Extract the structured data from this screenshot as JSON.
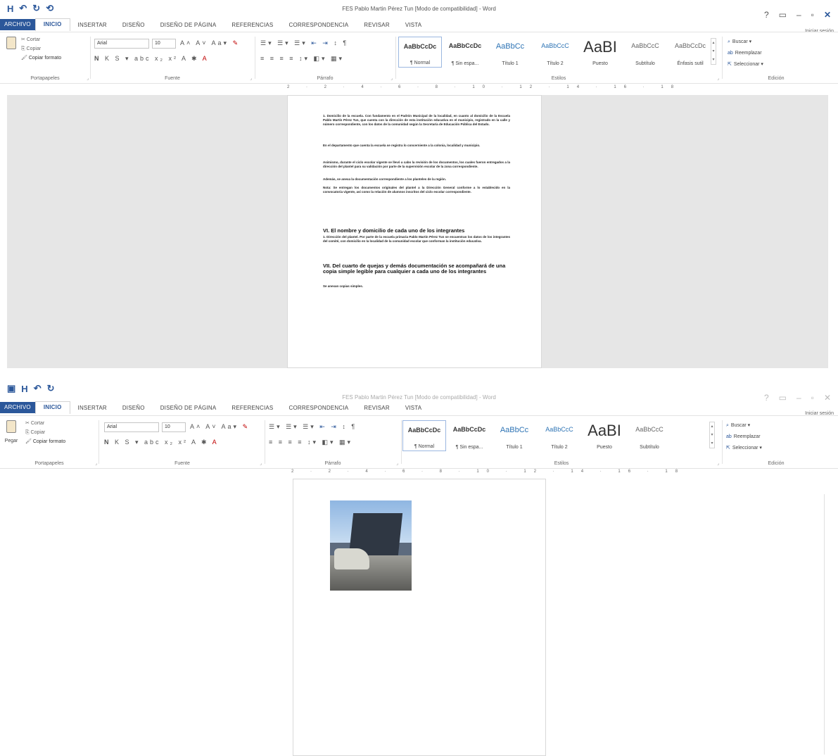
{
  "screen1": {
    "qat": [
      "H",
      "↶",
      "↻",
      "⟲"
    ],
    "title": "FES Pablo Martin Pérez Tun [Modo de compatibilidad] - Word",
    "window_controls": [
      "?",
      "▭",
      "–",
      "▫",
      "✕"
    ],
    "signin": "Iniciar sesión",
    "tabs": [
      "ARCHIVO",
      "INICIO",
      "INSERTAR",
      "DISEÑO",
      "DISEÑO DE PÁGINA",
      "REFERENCIAS",
      "CORRESPONDENCIA",
      "REVISAR",
      "VISTA"
    ],
    "clipboard": {
      "cut": "Cortar",
      "copy": "Copiar",
      "format_painter": "Copiar formato",
      "label": "Portapapeles"
    },
    "font": {
      "name": "Arial",
      "size": "10",
      "label": "Fuente"
    },
    "paragraph_label": "Párrafo",
    "styles": [
      {
        "sample": "AaBbCcDc",
        "name": "¶ Normal"
      },
      {
        "sample": "AaBbCcDc",
        "name": "¶ Sin espa..."
      },
      {
        "sample": "AaBbCc",
        "name": "Título 1"
      },
      {
        "sample": "AaBbCcC",
        "name": "Título 2"
      },
      {
        "sample": "AaBI",
        "name": "Puesto"
      },
      {
        "sample": "AaBbCcC",
        "name": "Subtítulo"
      },
      {
        "sample": "AaBbCcDc",
        "name": "Énfasis sutil"
      }
    ],
    "styles_label": "Estilos",
    "editing": {
      "find": "Buscar",
      "replace": "Reemplazar",
      "select": "Seleccionar",
      "label": "Edición"
    },
    "ruler": "2 · 2 · 4 · 6 · 8 · 10 · 12 · 14 · 16 · 18",
    "document": {
      "para1": "1. Domicilio de la escuela. Con fundamento en el Padrón Municipal de la localidad, en cuanto al domicilio de la Escuela Pablo Martín Pérez Tun, que cuenta con la dirección de esta institución educativa en el municipio, registrado en la calle y número correspondiente, con los datos de la comunidad según la Secretaría de Educación Pública del Estado.",
      "para2": "En el departamento que cuenta la escuela se registra lo concerniente a la colonia, localidad y municipio.",
      "para3": "Asimismo, durante el ciclo escolar vigente se llevó a cabo la revisión de los documentos, los cuales fueron entregados a la dirección del plantel para su validación por parte de la supervisión escolar de la zona correspondiente.",
      "para4": "Además, se anexa la documentación correspondiente a los planteles de la región.",
      "para5": "Nota: Se entregan los documentos originales del plantel a la Dirección General conforme a lo establecido en la convocatoria vigente, así como la relación de alumnos inscritos del ciclo escolar correspondiente.",
      "heading1": "VI. El nombre y domicilio de cada uno de los integrantes",
      "para6": "1. Dirección del plantel. Por parte de la escuela primaria Pablo Martín Pérez Tun se encuentran los datos de los integrantes del comité, con domicilio en la localidad de la comunidad escolar que conforman la institución educativa.",
      "heading2": "VII. Del cuarto de quejas y demás documentación se acompañará de una copia simple legible para cualquier a cada uno de los integrantes",
      "para7": "Se anexan copias simples."
    }
  },
  "screen2": {
    "qat": [
      "▣",
      "H",
      "↶",
      "↻"
    ],
    "title": "FES Pablo Martin Pérez Tun [Modo de compatibilidad] - Word",
    "window_controls": [
      "?",
      "▭",
      "–",
      "▫",
      "✕"
    ],
    "signin": "Iniciar sesión",
    "tabs": [
      "ARCHIVO",
      "INICIO",
      "INSERTAR",
      "DISEÑO",
      "DISEÑO DE PÁGINA",
      "REFERENCIAS",
      "CORRESPONDENCIA",
      "REVISAR",
      "VISTA"
    ],
    "clipboard": {
      "paste": "Pegar",
      "cut": "Cortar",
      "copy": "Copiar",
      "format_painter": "Copiar formato",
      "label": "Portapapeles"
    },
    "font": {
      "name": "Arial",
      "size": "10",
      "label": "Fuente"
    },
    "paragraph_label": "Párrafo",
    "styles_label": "Estilos",
    "editing": {
      "find": "Buscar",
      "replace": "Reemplazar",
      "select": "Seleccionar",
      "label": "Edición"
    },
    "ruler": "2 · 2 · 4 · 6 · 8 · 10 · 12 · 14 · 16 · 18"
  }
}
